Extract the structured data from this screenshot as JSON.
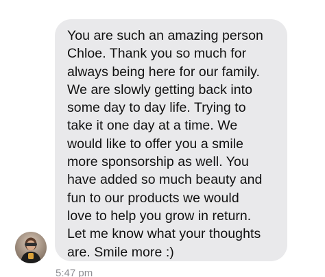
{
  "conversation": {
    "message": {
      "text": "You are such an amazing person\nChloe. Thank you so much for\nalways being here for our family.\nWe are slowly getting back into\nsome day to day life. Trying to\ntake it one day at a time. We\nwould like to offer you a smile\nmore sponsorship as well. You\nhave added so much beauty and\nfun to our products we would\nlove to help you grow in return.\nLet me know what your thoughts\nare. Smile more :)",
      "timestamp": "5:47 pm"
    },
    "sender": {
      "avatar_icon": "profile-photo"
    }
  },
  "colors": {
    "background": "#ffffff",
    "bubble": "#e9e9eb",
    "text": "#111111",
    "timestamp": "#8e8e93"
  }
}
